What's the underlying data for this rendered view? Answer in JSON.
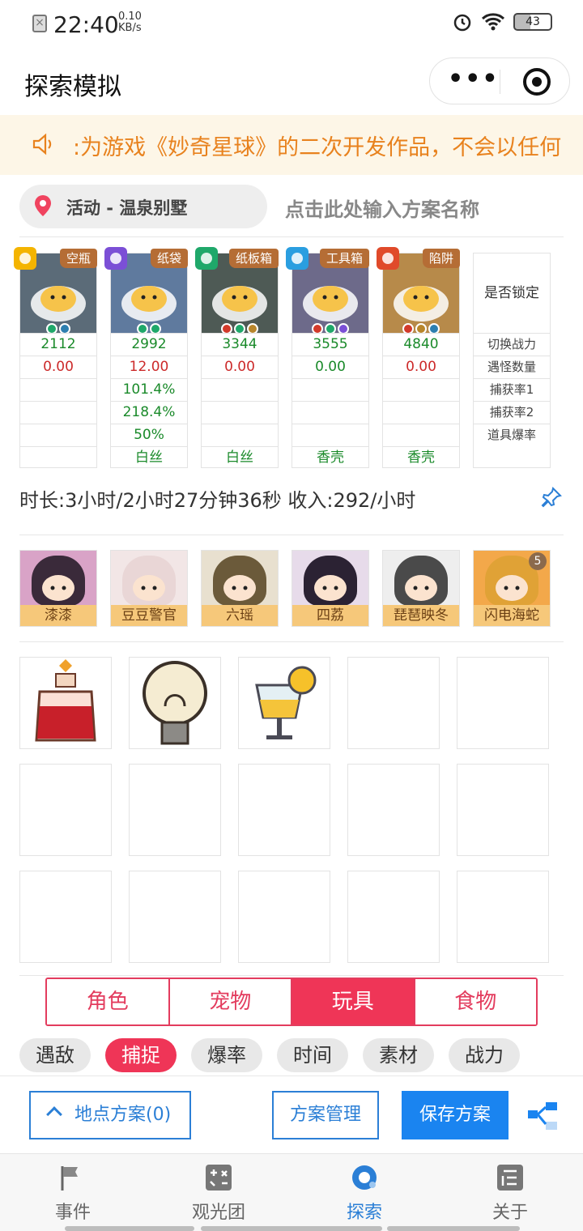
{
  "status_bar": {
    "time": "22:40",
    "speed_value": "0.10",
    "speed_unit": "KB/s",
    "battery": "43",
    "icons": [
      "no-sim-icon",
      "alarm-icon",
      "wifi-icon",
      "battery-icon"
    ]
  },
  "title_bar": {
    "title": "探索模拟"
  },
  "notice": {
    "text": ":为游戏《妙奇星球》的二次开发作品，不会以任何"
  },
  "location": {
    "label": "活动 - 温泉别墅",
    "plan_placeholder": "点击此处输入方案名称"
  },
  "pets": [
    {
      "tag": "空瓶",
      "element_color": "#f4b400",
      "bg": "#5b6b78",
      "power": "2112",
      "encounter": "0.00",
      "encounter_color": "red",
      "catch1": "",
      "catch2": "",
      "drop": "",
      "item": "",
      "gems": [
        "#1fa86a",
        "#2d7fb0"
      ]
    },
    {
      "tag": "纸袋",
      "element_color": "#7b4fd6",
      "bg": "#5f7a9e",
      "power": "2992",
      "encounter": "12.00",
      "encounter_color": "red",
      "catch1": "101.4%",
      "catch2": "218.4%",
      "drop": "50%",
      "item": "白丝",
      "gems": [
        "#1fa86a",
        "#1fa86a"
      ]
    },
    {
      "tag": "纸板箱",
      "element_color": "#1fa86a",
      "bg": "#4e5a55",
      "power": "3344",
      "encounter": "0.00",
      "encounter_color": "red",
      "catch1": "",
      "catch2": "",
      "drop": "",
      "item": "白丝",
      "gems": [
        "#d23a2a",
        "#1fa86a",
        "#b8862b"
      ]
    },
    {
      "tag": "工具箱",
      "element_color": "#2a9ee0",
      "bg": "#6d6a8a",
      "power": "3555",
      "encounter": "0.00",
      "encounter_color": "green",
      "catch1": "",
      "catch2": "",
      "drop": "",
      "item": "香壳",
      "gems": [
        "#d23a2a",
        "#1fa86a",
        "#7b4fd6"
      ]
    },
    {
      "tag": "陷阱",
      "element_color": "#e04a2a",
      "bg": "#b78a4a",
      "power": "4840",
      "encounter": "0.00",
      "encounter_color": "red",
      "catch1": "",
      "catch2": "",
      "drop": "",
      "item": "香壳",
      "gems": [
        "#d23a2a",
        "#b8862b",
        "#2d7fb0"
      ]
    }
  ],
  "lock_column": {
    "header": "是否锁定",
    "rows": [
      "切换战力",
      "遇怪数量",
      "捕获率1",
      "捕获率2",
      "道具爆率"
    ]
  },
  "duration_text": "时长:3小时/2小时27分钟36秒 收入:292/小时",
  "characters": [
    {
      "name": "漆漆",
      "face": "#3a2a3a",
      "bg": "#d9a3c7"
    },
    {
      "name": "豆豆警官",
      "face": "#e9d6d6",
      "bg": "#f2e6e6"
    },
    {
      "name": "六瑶",
      "face": "#6b5a3a",
      "bg": "#e8e0cf"
    },
    {
      "name": "四荔",
      "face": "#2b2233",
      "bg": "#e7dbea"
    },
    {
      "name": "琵琶映冬",
      "face": "#4a4a4a",
      "bg": "#eeeeee"
    },
    {
      "name": "闪电海蛇",
      "face": "#e0a236",
      "bg": "#f3a84a",
      "badge": "5"
    }
  ],
  "toys": [
    {
      "name": "potion-bottle",
      "filled": true
    },
    {
      "name": "light-bulb",
      "filled": true
    },
    {
      "name": "lemon-drink",
      "filled": true
    },
    {
      "filled": false
    },
    {
      "filled": false
    },
    {
      "filled": false
    },
    {
      "filled": false
    },
    {
      "filled": false
    },
    {
      "filled": false
    },
    {
      "filled": false
    },
    {
      "filled": false
    },
    {
      "filled": false
    },
    {
      "filled": false
    },
    {
      "filled": false
    },
    {
      "filled": false
    }
  ],
  "tabs": [
    "角色",
    "宠物",
    "玩具",
    "食物"
  ],
  "active_tab": 2,
  "chips": [
    "遇敌",
    "捕捉",
    "爆率",
    "时间",
    "素材",
    "战力"
  ],
  "active_chip": 1,
  "actions": {
    "location_plans": "地点方案(0)",
    "plan_manage": "方案管理",
    "save_plan": "保存方案"
  },
  "nav": [
    {
      "label": "事件",
      "icon": "flag-icon"
    },
    {
      "label": "观光团",
      "icon": "calculator-icon"
    },
    {
      "label": "探索",
      "icon": "explore-icon"
    },
    {
      "label": "关于",
      "icon": "list-icon"
    }
  ],
  "active_nav": 2,
  "colors": {
    "accent_red": "#ef3557",
    "accent_blue": "#1a84f0",
    "notice_orange": "#e8821e"
  }
}
